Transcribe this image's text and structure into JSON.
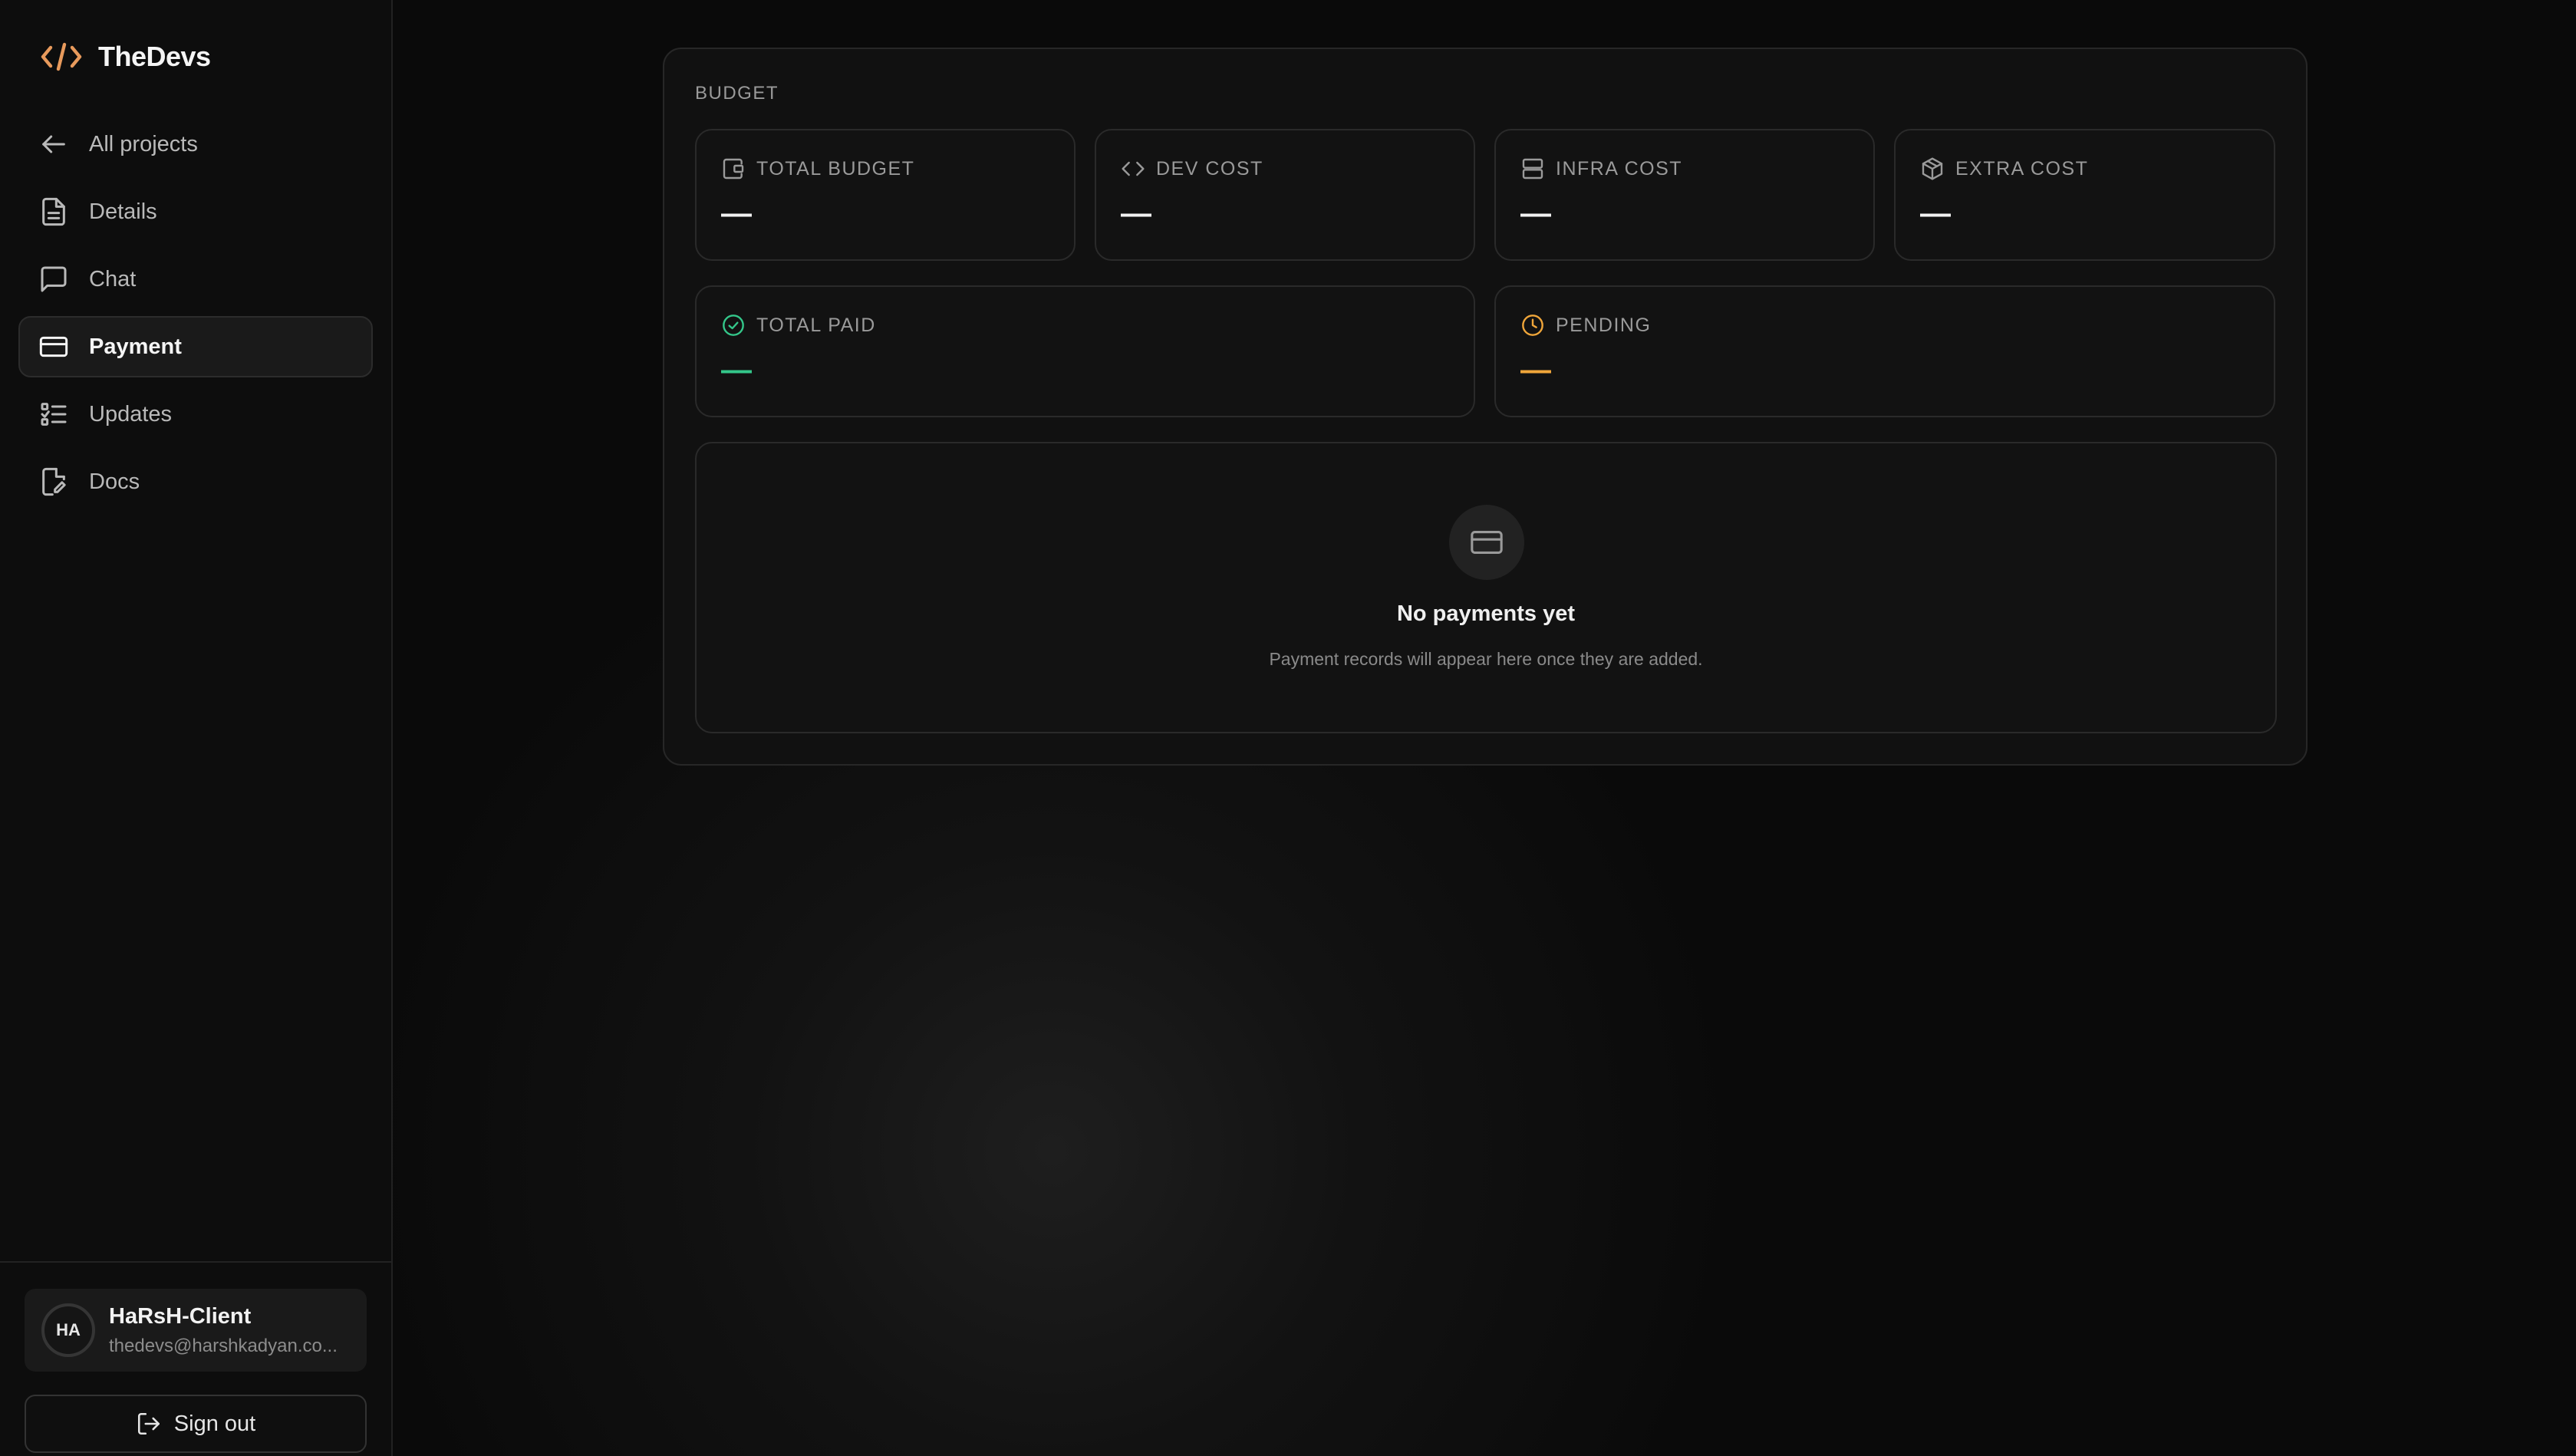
{
  "app": {
    "name": "TheDevs",
    "accent": "#e89a5c"
  },
  "sidebar": {
    "items": [
      {
        "label": "All projects",
        "icon": "arrow-left-icon"
      },
      {
        "label": "Details",
        "icon": "file-text-icon"
      },
      {
        "label": "Chat",
        "icon": "message-square-icon"
      },
      {
        "label": "Payment",
        "icon": "credit-card-icon",
        "active": true
      },
      {
        "label": "Updates",
        "icon": "list-checks-icon"
      },
      {
        "label": "Docs",
        "icon": "file-edit-icon"
      }
    ]
  },
  "user": {
    "initials": "HA",
    "name": "HaRsH-Client",
    "email": "thedevs@harshkadyan.co..."
  },
  "signout_label": "Sign out",
  "budget": {
    "title": "BUDGET",
    "cards": [
      {
        "label": "TOTAL BUDGET",
        "value": "—",
        "icon": "wallet-icon"
      },
      {
        "label": "DEV COST",
        "value": "—",
        "icon": "code-icon"
      },
      {
        "label": "INFRA COST",
        "value": "—",
        "icon": "server-icon"
      },
      {
        "label": "EXTRA COST",
        "value": "—",
        "icon": "package-icon"
      },
      {
        "label": "TOTAL PAID",
        "value": "—",
        "icon": "check-circle-icon",
        "color": "#34c78a"
      },
      {
        "label": "PENDING",
        "value": "—",
        "icon": "clock-icon",
        "color": "#f0a63a"
      }
    ],
    "empty": {
      "title": "No payments yet",
      "subtitle": "Payment records will appear here once they are added."
    }
  }
}
